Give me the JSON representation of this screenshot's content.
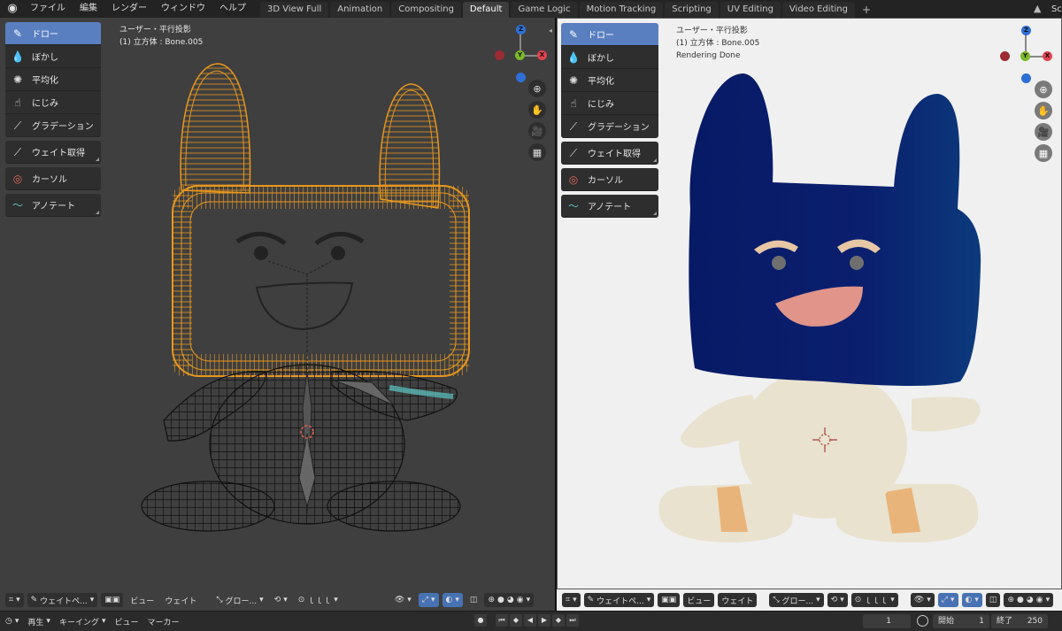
{
  "topbar": {
    "menus": [
      "ファイル",
      "編集",
      "レンダー",
      "ウィンドウ",
      "ヘルプ"
    ],
    "workspaces": [
      "3D View Full",
      "Animation",
      "Compositing",
      "Default",
      "Game Logic",
      "Motion Tracking",
      "Scripting",
      "UV Editing",
      "Video Editing"
    ],
    "active_workspace": "Default",
    "scene_label": "Sc"
  },
  "tools": [
    {
      "label": "ドロー",
      "icon": "brush-icon"
    },
    {
      "label": "ぼかし",
      "icon": "blur-icon"
    },
    {
      "label": "平均化",
      "icon": "average-icon"
    },
    {
      "label": "にじみ",
      "icon": "smear-icon"
    },
    {
      "label": "グラデーション",
      "icon": "gradient-icon"
    },
    {
      "label": "ウェイト取得",
      "icon": "sample-weight-icon"
    },
    {
      "label": "カーソル",
      "icon": "cursor-icon"
    },
    {
      "label": "アノテート",
      "icon": "annotate-icon"
    }
  ],
  "left_view": {
    "view_name": "ユーザー・平行投影",
    "object": "(1) 立方体 : Bone.005"
  },
  "right_view": {
    "view_name": "ユーザー・平行投影",
    "object": "(1) 立方体 : Bone.005",
    "status": "Rendering Done"
  },
  "gizmo": {
    "z": "Z",
    "y": "Y",
    "x": "X"
  },
  "header": {
    "mode": "ウェイトペ...",
    "view": "ビュー",
    "weight": "ウェイト",
    "orientation": "グロー...",
    "snap_label": "ｌｌｌ"
  },
  "timeline": {
    "playback": "再生",
    "keying": "キーイング",
    "view": "ビュー",
    "marker": "マーカー",
    "current_frame": "1",
    "start_label": "開始",
    "start": "1",
    "end_label": "終了",
    "end": "250"
  },
  "colors": {
    "active_tool": "#5a7fc0",
    "wire_orange": "#e8971e",
    "render_head": "#0a1f6e",
    "render_body": "#e9e2cf",
    "mouth": "#e0948a",
    "axis_x": "#e0424e",
    "axis_y": "#7cb828",
    "axis_z": "#2e6fd6"
  }
}
